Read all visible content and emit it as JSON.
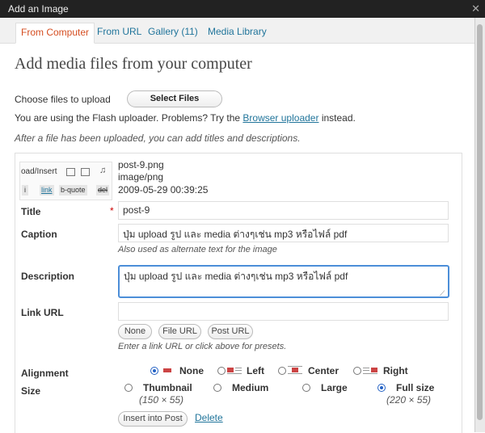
{
  "window": {
    "title": "Add an Image",
    "close": "✕"
  },
  "tabs": [
    {
      "label": "From Computer",
      "active": true
    },
    {
      "label": "From URL",
      "active": false
    },
    {
      "label": "Gallery (11)",
      "active": false
    },
    {
      "label": "Media Library",
      "active": false
    }
  ],
  "heading": "Add media files from your computer",
  "upload": {
    "choose_label": "Choose files to upload",
    "select_button": "Select Files",
    "flash_text": "You are using the Flash uploader. Problems? Try the",
    "browser_link": "Browser uploader",
    "flash_text_end": "instead.",
    "after_text": "After a file has been uploaded, you can add titles and descriptions."
  },
  "editor": {
    "toolbar_label": "oad/Insert",
    "buttons": [
      "i",
      "link",
      "b-quote",
      "del"
    ]
  },
  "file": {
    "name": "post-9.png",
    "type": "image/png",
    "date": "2009-05-29 00:39:25"
  },
  "form": {
    "title_label": "Title",
    "required_mark": "*",
    "title_value": "post-9",
    "caption_label": "Caption",
    "caption_value": "ปุ่ม upload รูป และ media ต่างๆเช่น mp3 หรือไฟล์ pdf",
    "caption_help": "Also used as alternate text for the image",
    "description_label": "Description",
    "description_value": "ปุ่ม upload รูป และ media ต่างๆเช่น mp3 หรือไฟล์ pdf",
    "link_label": "Link URL",
    "link_value": "",
    "link_buttons": [
      "None",
      "File URL",
      "Post URL"
    ],
    "link_help": "Enter a link URL or click above for presets.",
    "alignment_label": "Alignment",
    "alignments": [
      {
        "label": "None",
        "selected": true
      },
      {
        "label": "Left",
        "selected": false
      },
      {
        "label": "Center",
        "selected": false
      },
      {
        "label": "Right",
        "selected": false
      }
    ],
    "size_label": "Size",
    "sizes": [
      {
        "label": "Thumbnail",
        "dims": "(150 × 55)",
        "selected": false
      },
      {
        "label": "Medium",
        "dims": "",
        "selected": false
      },
      {
        "label": "Large",
        "dims": "",
        "selected": false
      },
      {
        "label": "Full size",
        "dims": "(220 × 55)",
        "selected": true
      }
    ],
    "insert_button": "Insert into Post",
    "delete_link": "Delete"
  },
  "colors": {
    "accent": "#21759b",
    "active_tab": "#d54e21",
    "focus": "#4c8ed8"
  }
}
